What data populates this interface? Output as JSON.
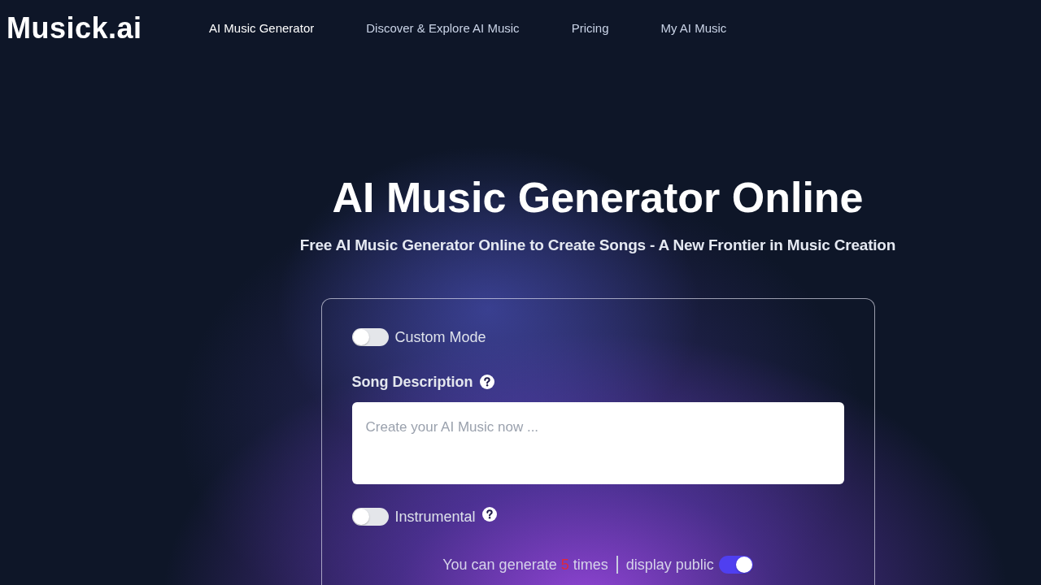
{
  "brand": {
    "logo": "Musick.ai"
  },
  "nav": [
    {
      "label": "AI Music Generator",
      "selected": true
    },
    {
      "label": "Discover & Explore AI Music",
      "selected": false
    },
    {
      "label": "Pricing",
      "selected": false
    },
    {
      "label": "My AI Music",
      "selected": false
    }
  ],
  "hero": {
    "title": "AI Music Generator Online",
    "subtitle": "Free AI Music Generator Online to Create Songs - A New Frontier in Music Creation"
  },
  "form": {
    "custom_mode": {
      "label": "Custom Mode",
      "on": false
    },
    "song_description": {
      "label": "Song Description",
      "placeholder": "Create your AI Music now ..."
    },
    "instrumental": {
      "label": "Instrumental",
      "on": false
    },
    "quota": {
      "prefix": "You can generate",
      "count": "5",
      "suffix": "times"
    },
    "display_public": {
      "label": "display public",
      "on": true
    }
  }
}
